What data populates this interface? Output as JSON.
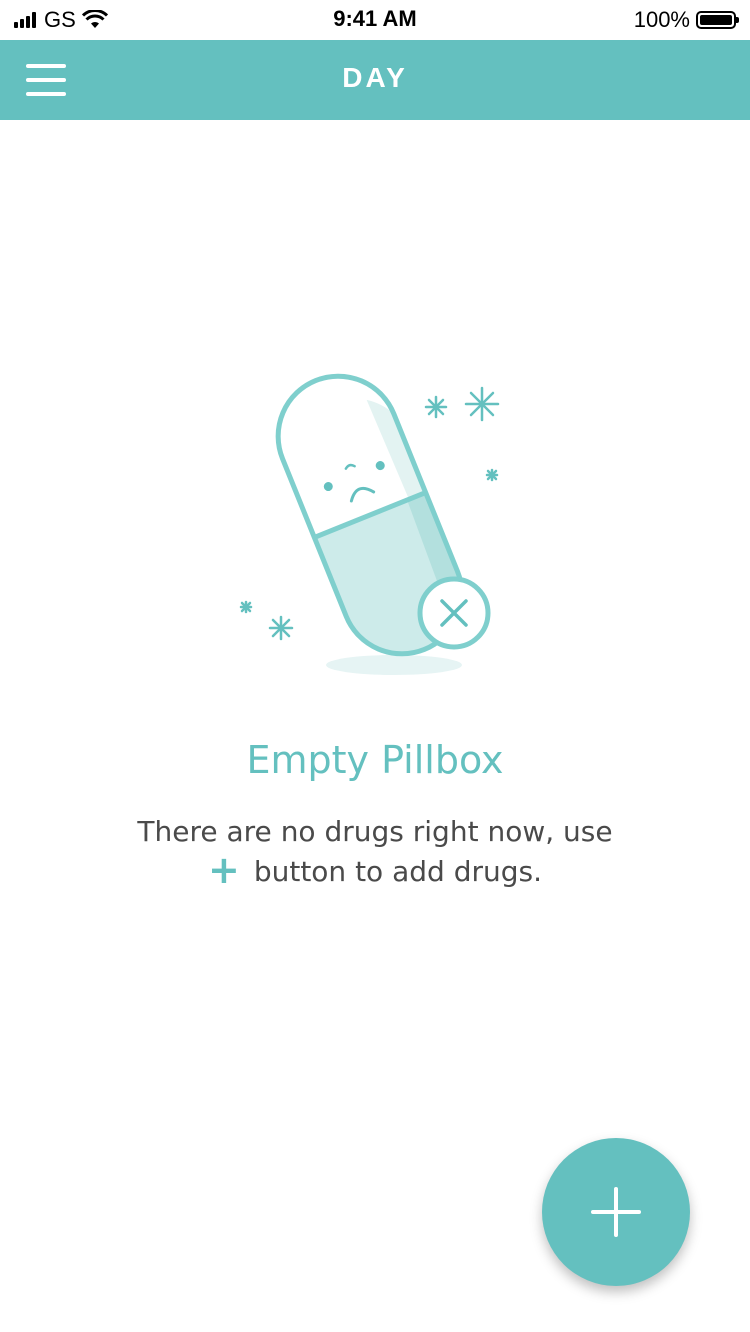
{
  "status_bar": {
    "carrier": "GS",
    "time": "9:41 AM",
    "battery": "100%"
  },
  "nav": {
    "title": "DAY",
    "menu_icon": "hamburger-icon"
  },
  "empty_state": {
    "illustration_icon": "sad-pill-icon",
    "title": "Empty Pillbox",
    "message_line1": "There are no drugs right now, use",
    "plus_glyph": "+",
    "message_line2": "button to add drugs."
  },
  "fab": {
    "icon": "plus-icon"
  },
  "colors": {
    "accent": "#64c0bf",
    "pill_fill": "#cdebea",
    "text": "#4a4a4a"
  }
}
